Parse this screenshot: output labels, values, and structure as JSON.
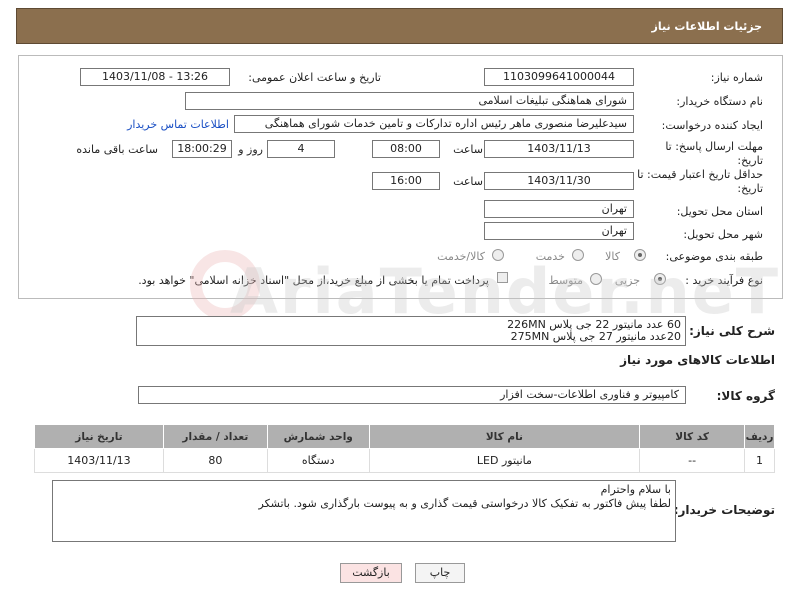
{
  "header": {
    "title": "جزئیات اطلاعات نیاز"
  },
  "form": {
    "need_number_label": "شماره نیاز:",
    "need_number": "1103099641000044",
    "announce_label": "تاریخ و ساعت اعلان عمومی:",
    "announce_value": "1403/11/08 - 13:26",
    "buyer_org_label": "نام دستگاه خریدار:",
    "buyer_org": "شورای هماهنگی تبلیغات اسلامی",
    "creator_label": "ایجاد کننده درخواست:",
    "creator": "سیدعلیرضا منصوری ماهر رئیس اداره تدارکات و تامین خدمات  شورای هماهنگی",
    "contact_link": "اطلاعات تماس خریدار",
    "deadline_label": "مهلت ارسال پاسخ: تا تاریخ:",
    "deadline_date": "1403/11/13",
    "time_label": "ساعت",
    "deadline_time": "08:00",
    "days_value": "4",
    "days_label": "روز و",
    "remaining_time": "18:00:29",
    "remaining_label": "ساعت باقی مانده",
    "validity_label": "حداقل تاریخ اعتبار قیمت: تا تاریخ:",
    "validity_date": "1403/11/30",
    "validity_time": "16:00",
    "province_label": "استان محل تحویل:",
    "province": "تهران",
    "city_label": "شهر محل تحویل:",
    "city": "تهران",
    "category_label": "طبقه بندی موضوعی:",
    "category_options": [
      "کالا",
      "خدمت",
      "کالا/خدمت"
    ],
    "process_label": "نوع فرآیند خرید :",
    "process_options": [
      "جزیی",
      "متوسط"
    ],
    "payment_note": "پرداخت تمام یا بخشی از مبلغ خرید،از محل \"اسناد خزانه اسلامی\" خواهد بود."
  },
  "summary": {
    "label": "شرح کلی نیاز:",
    "line1": "60 عدد مانیتور 22 جی پلاس 226MN",
    "line2": "20عدد مانیتور 27 جی پلاس 275MN"
  },
  "goods_section": {
    "title": "اطلاعات کالاهای مورد نیاز",
    "group_label": "گروه کالا:",
    "group_value": "کامپیوتر و فناوری اطلاعات-سخت افزار"
  },
  "table": {
    "headers": [
      "ردیف",
      "کد کالا",
      "نام کالا",
      "واحد شمارش",
      "تعداد / مقدار",
      "تاریخ نیاز"
    ],
    "rows": [
      [
        "1",
        "--",
        "مانیتور LED",
        "دستگاه",
        "80",
        "1403/11/13"
      ]
    ]
  },
  "buyer_notes": {
    "label": "توضیحات خریدار:",
    "line1": "با سلام واحترام",
    "line2": "لطفا پیش فاکتور به تفکیک کالا درخواستی قیمت گذاری و به پیوست بارگذاری شود. باتشکر"
  },
  "buttons": {
    "print": "چاپ",
    "back": "بازگشت"
  },
  "colors": {
    "header_bg": "#8b6f4e",
    "table_header_bg": "#b0b0b0",
    "link": "#1a4fc4",
    "back_button_bg": "#fbe3e3"
  }
}
